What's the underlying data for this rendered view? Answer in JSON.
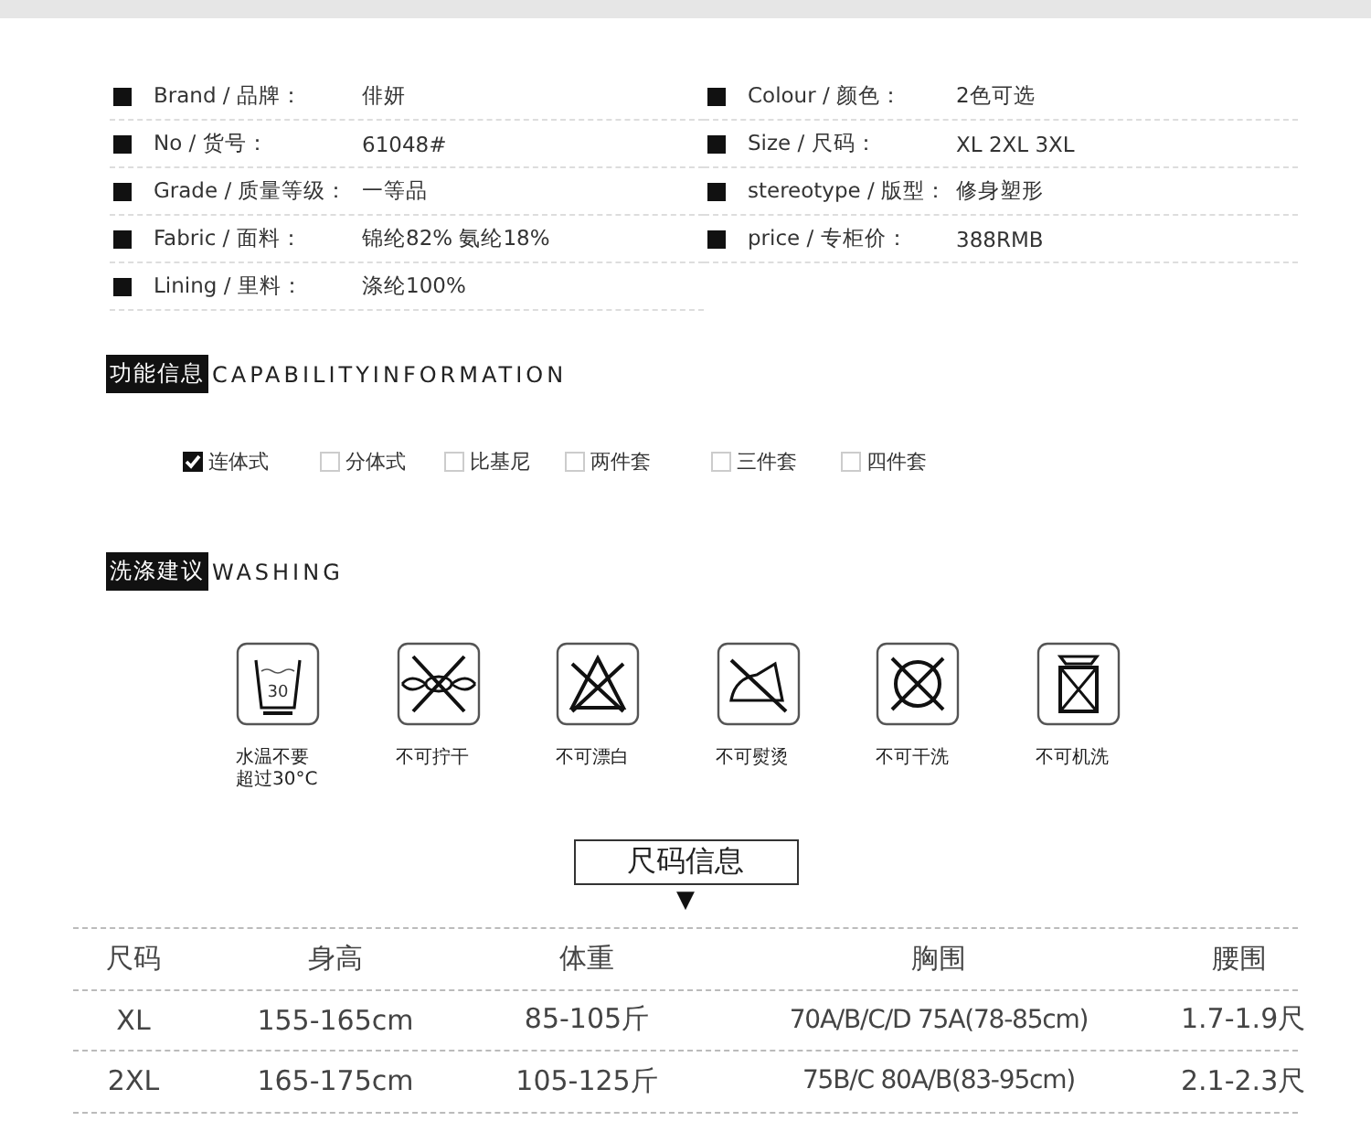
{
  "specs": [
    {
      "label": "Brand / 品牌：",
      "value": "俳妍"
    },
    {
      "label": "Colour / 颜色：",
      "value": "2色可选"
    },
    {
      "label": "No / 货号：",
      "value": "61048#"
    },
    {
      "label": "Size / 尺码：",
      "value": "XL 2XL 3XL"
    },
    {
      "label": "Grade / 质量等级：",
      "value": "一等品"
    },
    {
      "label": "stereotype / 版型：",
      "value": "修身塑形"
    },
    {
      "label": "Fabric / 面料：",
      "value": "锦纶82% 氨纶18%"
    },
    {
      "label": "price / 专柜价：",
      "value": "388RMB"
    },
    {
      "label": "Lining / 里料：",
      "value": "涤纶100%"
    }
  ],
  "capability": {
    "badge": "功能信息",
    "title": "CAPABILITYINFORMATION",
    "options": [
      {
        "label": "连体式",
        "checked": true
      },
      {
        "label": "分体式",
        "checked": false
      },
      {
        "label": "比基尼",
        "checked": false
      },
      {
        "label": "两件套",
        "checked": false
      },
      {
        "label": "三件套",
        "checked": false
      },
      {
        "label": "四件套",
        "checked": false
      }
    ]
  },
  "washing": {
    "badge": "洗涤建议",
    "title": "WASHING",
    "items": [
      {
        "kind": "wash30",
        "temp": "30",
        "label": "水温不要超过30°C"
      },
      {
        "kind": "nowring",
        "label": "不可拧干"
      },
      {
        "kind": "nobleach",
        "label": "不可漂白"
      },
      {
        "kind": "noiron",
        "label": "不可熨烫"
      },
      {
        "kind": "nodryclean",
        "label": "不可干洗"
      },
      {
        "kind": "nomachine",
        "label": "不可机洗"
      }
    ]
  },
  "size_info": {
    "title": "尺码信息",
    "marker": "▼",
    "columns": [
      "尺码",
      "身高",
      "体重",
      "胸围",
      "腰围"
    ],
    "rows": [
      [
        "XL",
        "155-165cm",
        "85-105斤",
        "70A/B/C/D 75A(78-85cm)",
        "1.7-1.9尺"
      ],
      [
        "2XL",
        "165-175cm",
        "105-125斤",
        "75B/C 80A/B(83-95cm)",
        "2.1-2.3尺"
      ]
    ]
  }
}
